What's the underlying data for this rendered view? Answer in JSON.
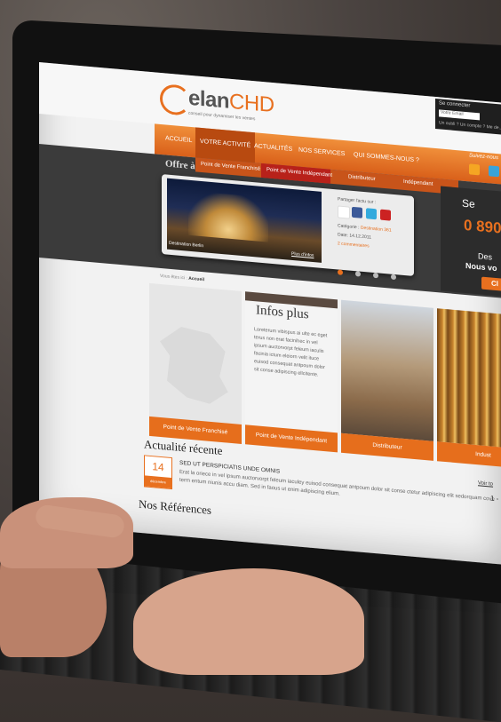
{
  "site": {
    "logo_main": "elan",
    "logo_accent": "CHD",
    "logo_tagline": "conseil pour dynamiser les ventes"
  },
  "login": {
    "title": "Se connecter",
    "input_placeholder": "Votre Email",
    "links": "Un oubli ?  Un compte ?  Me de..."
  },
  "nav": {
    "items": [
      "ACCUEIL",
      "VOTRE ACTIVITÉ",
      "ACTUALITÉS",
      "NOS SERVICES",
      "QUI SOMMES-NOUS ?"
    ],
    "active_index": 1,
    "follow": "Suivez-nous"
  },
  "subnav": {
    "items": [
      "Point de Vente Franchisé",
      "Point de Vente Indépendant",
      "Distributeur",
      "Indépendant"
    ]
  },
  "hero": {
    "offer_heading": "Offre à",
    "caption": "Destination Berlin",
    "more_link": "Plus d'infos",
    "share_label": "Partager l'actu sur :",
    "category_label": "Catégorie :",
    "category_value": "Destination 361",
    "date": "Date: 14.12.2011",
    "comments": "2 commentaires",
    "slide_count": 4,
    "slide_active": 0
  },
  "promo": {
    "phone_prefix": "Se",
    "number": "0 890",
    "line1": "Des",
    "line2": "Nous vo",
    "button": "Cl"
  },
  "breadcrumb": {
    "prefix": "Vous êtes ici :",
    "current": "Accueil"
  },
  "tiles": [
    {
      "label": "Point de Vente Franchisé"
    },
    {
      "label": "Point de Vente Indépendant",
      "title": "Infos plus",
      "body": "Loreterum vibispus ai ulte ec eget terus non erat facinihec in vel ipsum auctorvorpt feleum iaculis facinia ictum eleiorn velit ituce euisod consequat antpoum dolor sit conse adipiscing ellcitente."
    },
    {
      "label": "Distributeur"
    },
    {
      "label": "Indust"
    }
  ],
  "news": {
    "heading": "Actualité récente",
    "day": "14",
    "month": "décembre",
    "title": "SED UT PERSPICIATIS UNDE OMNIS",
    "body": "Erat la oriece in vel ipsum auctorvorpt feleum iaculey euisod consequat antpoum dolor sit conse ctetur adipiscing elit sedorquam cove term entum niunis accu diam. Sed in faous ut enim adipiscing elium.",
    "all_link": "Voir to",
    "pagination": "1 -"
  },
  "references": {
    "heading": "Nos Références"
  },
  "colors": {
    "accent": "#e8701f",
    "nav_dark": "#b84a10",
    "sub_red": "#b8211a",
    "dark_band": "#3b3b3b"
  }
}
